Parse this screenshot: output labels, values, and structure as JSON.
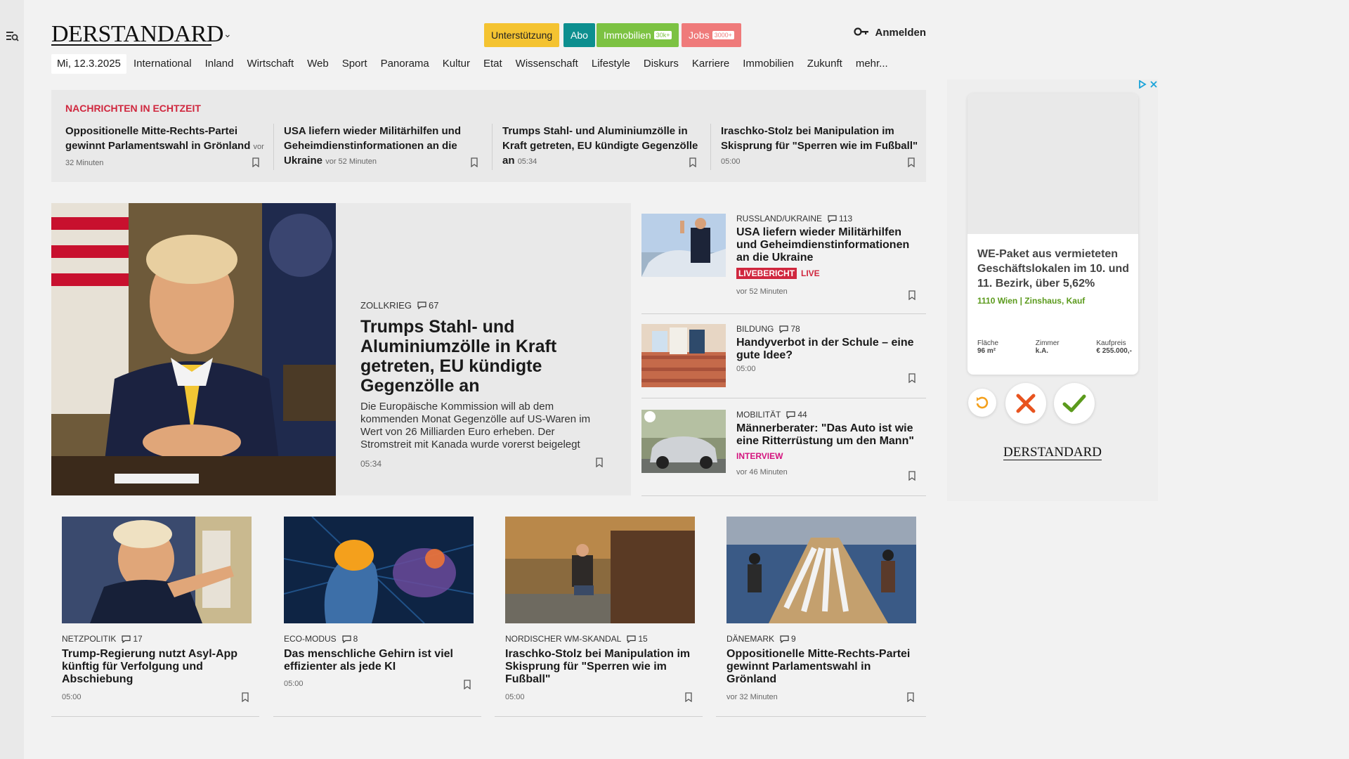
{
  "header": {
    "logo": "DERSTANDARD",
    "buttons": [
      {
        "label": "Unterstützung",
        "bg": "#f4c331",
        "color": "#222",
        "badge": ""
      },
      {
        "label": "Abo",
        "bg": "#0d8f8f",
        "color": "#ffffff",
        "badge": ""
      },
      {
        "label": "Immobilien",
        "bg": "#7cc242",
        "color": "#ffffff",
        "badge": "30k+"
      },
      {
        "label": "Jobs",
        "bg": "#ef7a7a",
        "color": "#ffffff",
        "badge": "3000+"
      }
    ],
    "login_label": "Anmelden"
  },
  "nav": {
    "date": "Mi, 12.3.2025",
    "items": [
      "International",
      "Inland",
      "Wirtschaft",
      "Web",
      "Sport",
      "Panorama",
      "Kultur",
      "Etat",
      "Wissenschaft",
      "Lifestyle",
      "Diskurs",
      "Karriere",
      "Immobilien",
      "Zukunft",
      "mehr..."
    ]
  },
  "realtime": {
    "title": "NACHRICHTEN IN ECHTZEIT",
    "items": [
      {
        "title": "Oppositionelle Mitte-Rechts-Partei gewinnt Parlamentswahl in Grönland",
        "time": "vor 32 Minuten"
      },
      {
        "title": "USA liefern wieder Militärhilfen und Geheimdienstinformationen an die Ukraine",
        "time": "vor 52 Minuten"
      },
      {
        "title": "Trumps Stahl- und Aluminiumzölle in Kraft getreten, EU kündigte Gegenzölle an",
        "time": "05:34"
      },
      {
        "title": "Iraschko-Stolz bei Manipulation im Skisprung für \"Sperren wie im Fußball\"",
        "time": "05:00"
      }
    ]
  },
  "hero": {
    "kicker": "ZOLLKRIEG",
    "comments": "67",
    "title": "Trumps Stahl- und Aluminiumzölle in Kraft getreten, EU kündigte Gegenzölle an",
    "teaser": "Die Europäische Kommission will ab dem kommenden Monat Gegenzölle auf US-Waren im Wert von 26 Milliarden Euro erheben. Der Stromstreit mit Kanada wurde vorerst beigelegt",
    "time": "05:34"
  },
  "side": [
    {
      "kicker": "RUSSLAND/UKRAINE",
      "comments": "113",
      "title": "USA liefern wieder Militärhilfen und Geheimdienstinformationen an die Ukraine",
      "tag1": "LIVEBERICHT",
      "tag2": "LIVE",
      "time": "vor 52 Minuten"
    },
    {
      "kicker": "BILDUNG",
      "comments": "78",
      "title": "Handyverbot in der Schule – eine gute Idee?",
      "time": "05:00"
    },
    {
      "kicker": "MOBILITÄT",
      "comments": "44",
      "title": "Männerberater: \"Das Auto ist wie eine Ritterrüstung um den Mann\"",
      "tag": "INTERVIEW",
      "time": "vor 46 Minuten"
    }
  ],
  "cards": [
    {
      "kicker": "NETZPOLITIK",
      "comments": "17",
      "title": "Trump-Regierung nutzt Asyl-App künftig für Verfolgung und Abschiebung",
      "time": "05:00"
    },
    {
      "kicker": "ECO-MODUS",
      "comments": "8",
      "title": "Das menschliche Gehirn ist viel effizienter als jede KI",
      "time": "05:00"
    },
    {
      "kicker": "NORDISCHER WM-SKANDAL",
      "comments": "15",
      "title": "Iraschko-Stolz bei Manipulation im Skisprung für \"Sperren wie im Fußball\"",
      "time": "05:00"
    },
    {
      "kicker": "DÄNEMARK",
      "comments": "9",
      "title": "Oppositionelle Mitte-Rechts-Partei gewinnt Parlamentswahl in Grönland",
      "time": "vor 32 Minuten"
    }
  ],
  "ad": {
    "headline": "WE-Paket aus vermieteten Geschäftslokalen im 10. und 11. Bezirk, über 5,62%",
    "sub": "1110 Wien | Zinshaus, Kauf",
    "stats": [
      {
        "label": "Fläche",
        "value": "96 m²"
      },
      {
        "label": "Zimmer",
        "value": "k.A."
      },
      {
        "label": "Kaufpreis",
        "value": "€ 255.000,-"
      }
    ],
    "logo": "DERSTANDARD"
  },
  "colors": {
    "accent_red": "#d0273e",
    "live_red": "#d0273e",
    "interview_pink": "#d4137e",
    "ad_green": "#5b9a1c"
  }
}
